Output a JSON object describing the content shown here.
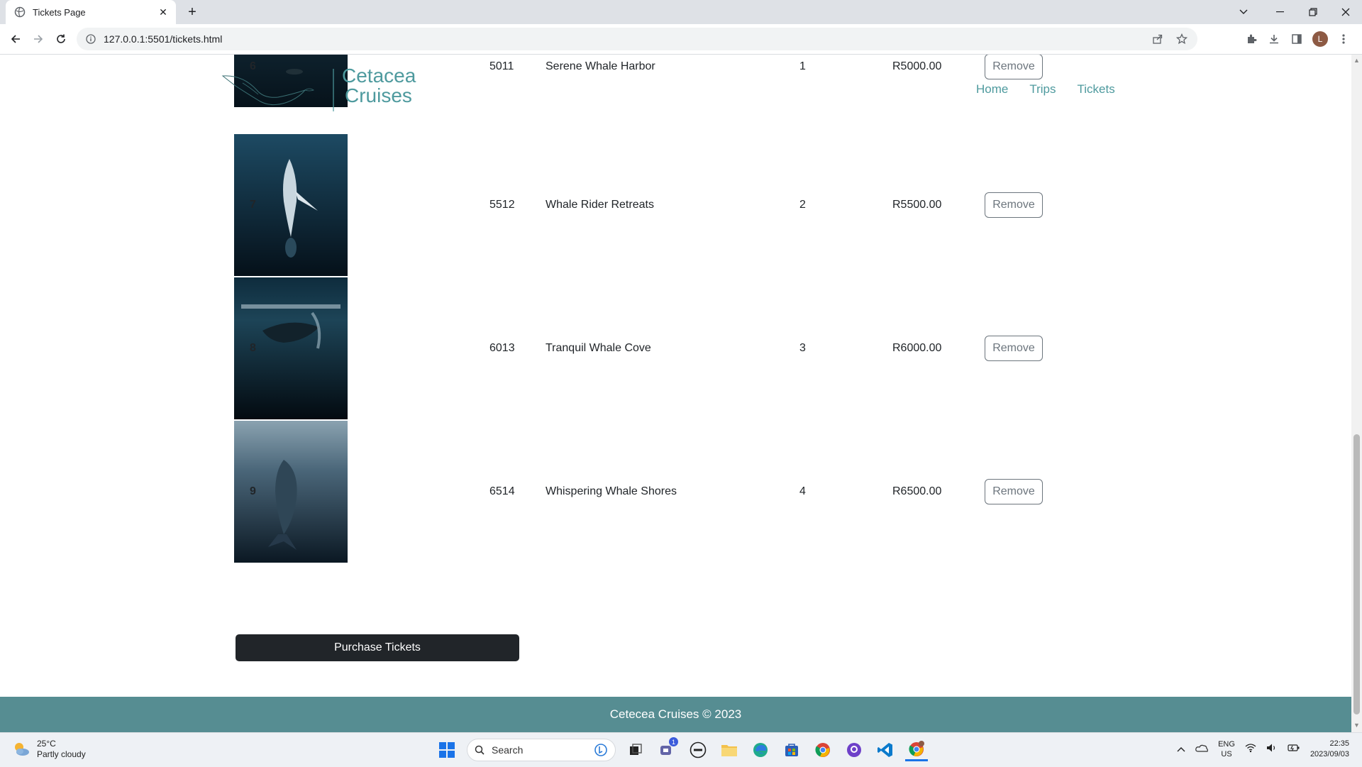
{
  "browser": {
    "tab_title": "Tickets Page",
    "url": "127.0.0.1:5501/tickets.html",
    "profile_initial": "L"
  },
  "site": {
    "logo_line1": "Cetacea",
    "logo_line2": "Cruises",
    "nav": [
      "Home",
      "Trips",
      "Tickets"
    ],
    "purchase_label": "Purchase Tickets",
    "footer": "Cetecea Cruises © 2023"
  },
  "tickets": [
    {
      "num": "6",
      "code": "5011",
      "name": "Serene Whale Harbor",
      "qty": "1",
      "price": "R5000.00",
      "action": "Remove"
    },
    {
      "num": "7",
      "code": "5512",
      "name": "Whale Rider Retreats",
      "qty": "2",
      "price": "R5500.00",
      "action": "Remove"
    },
    {
      "num": "8",
      "code": "6013",
      "name": "Tranquil Whale Cove",
      "qty": "3",
      "price": "R6000.00",
      "action": "Remove"
    },
    {
      "num": "9",
      "code": "6514",
      "name": "Whispering Whale Shores",
      "qty": "4",
      "price": "R6500.00",
      "action": "Remove"
    }
  ],
  "taskbar": {
    "temperature": "25°C",
    "weather": "Partly cloudy",
    "search_placeholder": "Search",
    "lang1": "ENG",
    "lang2": "US",
    "time": "22:35",
    "date": "2023/09/03",
    "teams_badge": "1"
  },
  "colors": {
    "accent": "#4e9a9e",
    "footer": "#568d92",
    "button_dark": "#212529"
  }
}
